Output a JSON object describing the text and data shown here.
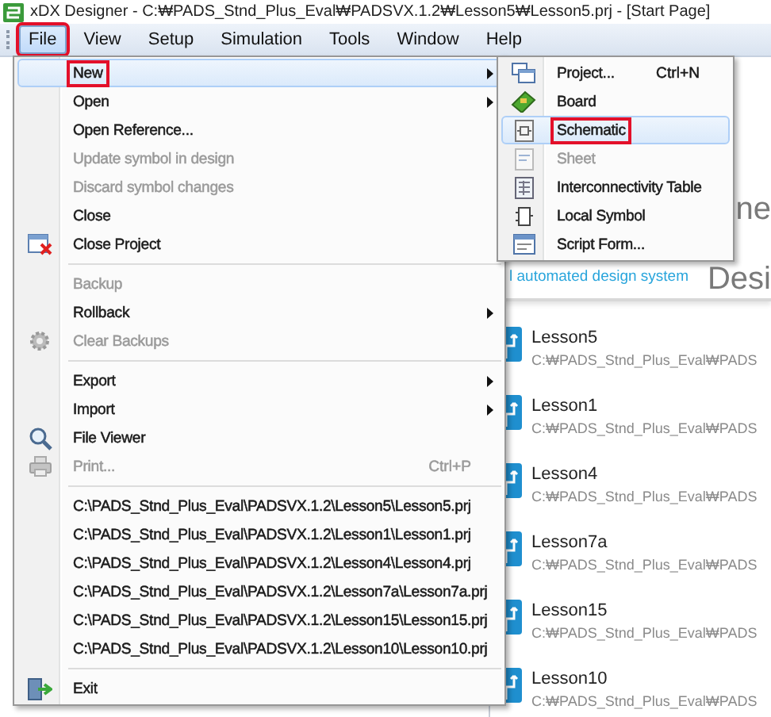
{
  "window": {
    "title": "xDX Designer - C:₩PADS_Stnd_Plus_Eval₩PADSVX.1.2₩Lesson5₩Lesson5.prj - [Start Page]"
  },
  "menubar": [
    {
      "label": "File",
      "selected": true,
      "highlighted": true
    },
    {
      "label": "View",
      "selected": false,
      "highlighted": false
    },
    {
      "label": "Setup",
      "selected": false,
      "highlighted": false
    },
    {
      "label": "Simulation",
      "selected": false,
      "highlighted": false
    },
    {
      "label": "Tools",
      "selected": false,
      "highlighted": false
    },
    {
      "label": "Window",
      "selected": false,
      "highlighted": false
    },
    {
      "label": "Help",
      "selected": false,
      "highlighted": false
    }
  ],
  "file_menu": {
    "items": [
      {
        "kind": "item",
        "label": "New",
        "submenu": true,
        "disabled": false,
        "selected": true,
        "highlighted": true
      },
      {
        "kind": "item",
        "label": "Open",
        "submenu": true,
        "disabled": false,
        "selected": false,
        "highlighted": false
      },
      {
        "kind": "item",
        "label": "Open Reference...",
        "submenu": false,
        "disabled": false,
        "selected": false,
        "highlighted": false
      },
      {
        "kind": "item",
        "label": "Update symbol in design",
        "submenu": false,
        "disabled": true,
        "selected": false,
        "highlighted": false
      },
      {
        "kind": "item",
        "label": "Discard symbol changes",
        "submenu": false,
        "disabled": true,
        "selected": false,
        "highlighted": false
      },
      {
        "kind": "item",
        "label": "Close",
        "submenu": false,
        "disabled": false,
        "selected": false,
        "highlighted": false
      },
      {
        "kind": "item",
        "label": "Close Project",
        "submenu": false,
        "disabled": false,
        "selected": false,
        "highlighted": false
      },
      {
        "kind": "separator"
      },
      {
        "kind": "item",
        "label": "Backup",
        "submenu": false,
        "disabled": true,
        "selected": false,
        "highlighted": false
      },
      {
        "kind": "item",
        "label": "Rollback",
        "submenu": true,
        "disabled": false,
        "selected": false,
        "highlighted": false
      },
      {
        "kind": "item",
        "label": "Clear Backups",
        "submenu": false,
        "disabled": true,
        "selected": false,
        "highlighted": false
      },
      {
        "kind": "separator"
      },
      {
        "kind": "item",
        "label": "Export",
        "submenu": true,
        "disabled": false,
        "selected": false,
        "highlighted": false
      },
      {
        "kind": "item",
        "label": "Import",
        "submenu": true,
        "disabled": false,
        "selected": false,
        "highlighted": false
      },
      {
        "kind": "item",
        "label": "File Viewer",
        "submenu": false,
        "disabled": false,
        "selected": false,
        "highlighted": false
      },
      {
        "kind": "item",
        "label": "Print...",
        "shortcut": "Ctrl+P",
        "submenu": false,
        "disabled": true,
        "selected": false,
        "highlighted": false
      },
      {
        "kind": "separator"
      },
      {
        "kind": "item",
        "label": "C:\\PADS_Stnd_Plus_Eval\\PADSVX.1.2\\Lesson5\\Lesson5.prj",
        "submenu": false,
        "disabled": false,
        "selected": false,
        "highlighted": false
      },
      {
        "kind": "item",
        "label": "C:\\PADS_Stnd_Plus_Eval\\PADSVX.1.2\\Lesson1\\Lesson1.prj",
        "submenu": false,
        "disabled": false,
        "selected": false,
        "highlighted": false
      },
      {
        "kind": "item",
        "label": "C:\\PADS_Stnd_Plus_Eval\\PADSVX.1.2\\Lesson4\\Lesson4.prj",
        "submenu": false,
        "disabled": false,
        "selected": false,
        "highlighted": false
      },
      {
        "kind": "item",
        "label": "C:\\PADS_Stnd_Plus_Eval\\PADSVX.1.2\\Lesson7a\\Lesson7a.prj",
        "submenu": false,
        "disabled": false,
        "selected": false,
        "highlighted": false
      },
      {
        "kind": "item",
        "label": "C:\\PADS_Stnd_Plus_Eval\\PADSVX.1.2\\Lesson15\\Lesson15.prj",
        "submenu": false,
        "disabled": false,
        "selected": false,
        "highlighted": false
      },
      {
        "kind": "item",
        "label": "C:\\PADS_Stnd_Plus_Eval\\PADSVX.1.2\\Lesson10\\Lesson10.prj",
        "submenu": false,
        "disabled": false,
        "selected": false,
        "highlighted": false
      },
      {
        "kind": "separator"
      },
      {
        "kind": "item",
        "label": "Exit",
        "submenu": false,
        "disabled": false,
        "selected": false,
        "highlighted": false
      }
    ]
  },
  "new_submenu": {
    "items": [
      {
        "label": "Project...",
        "shortcut": "Ctrl+N",
        "disabled": false,
        "selected": false,
        "highlighted": false
      },
      {
        "label": "Board",
        "disabled": false,
        "selected": false,
        "highlighted": false
      },
      {
        "label": "Schematic",
        "disabled": false,
        "selected": true,
        "highlighted": true
      },
      {
        "label": "Sheet",
        "disabled": true,
        "selected": false,
        "highlighted": false
      },
      {
        "label": "Interconnectivity Table",
        "disabled": false,
        "selected": false,
        "highlighted": false
      },
      {
        "label": "Local Symbol",
        "disabled": false,
        "selected": false,
        "highlighted": false
      },
      {
        "label": "Script Form...",
        "disabled": false,
        "selected": false,
        "highlighted": false
      }
    ]
  },
  "start_page": {
    "heading_lines": [
      "ne",
      "Desi"
    ],
    "tagline": "l automated design system",
    "projects": [
      {
        "name": "Lesson5",
        "path": "C:₩PADS_Stnd_Plus_Eval₩PADS"
      },
      {
        "name": "Lesson1",
        "path": "C:₩PADS_Stnd_Plus_Eval₩PADS"
      },
      {
        "name": "Lesson4",
        "path": "C:₩PADS_Stnd_Plus_Eval₩PADS"
      },
      {
        "name": "Lesson7a",
        "path": "C:₩PADS_Stnd_Plus_Eval₩PADS"
      },
      {
        "name": "Lesson15",
        "path": "C:₩PADS_Stnd_Plus_Eval₩PADS"
      },
      {
        "name": "Lesson10",
        "path": "C:₩PADS_Stnd_Plus_Eval₩PADS"
      }
    ]
  }
}
